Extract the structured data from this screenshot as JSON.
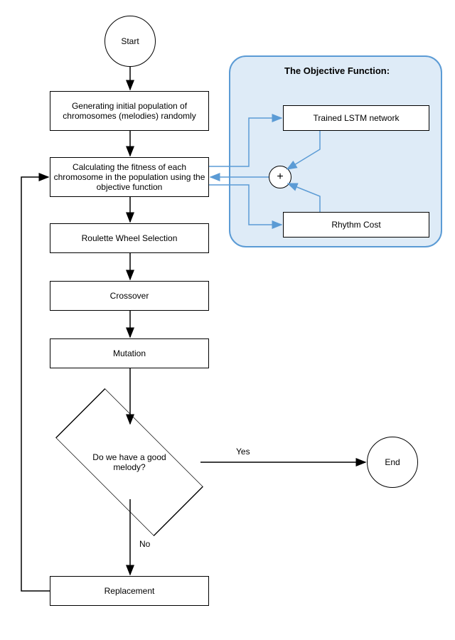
{
  "terminals": {
    "start": "Start",
    "end": "End"
  },
  "processes": {
    "generate": "Generating initial population of chromosomes (melodies) randomly",
    "fitness": "Calculating the fitness of each chromosome in the population using the objective function",
    "selection": "Roulette Wheel Selection",
    "crossover": "Crossover",
    "mutation": "Mutation",
    "replacement": "Replacement"
  },
  "decision": {
    "melody": "Do we have a good melody?"
  },
  "objective": {
    "title": "The Objective Function:",
    "lstm": "Trained LSTM network",
    "rhythm": "Rhythm Cost",
    "plus": "+"
  },
  "labels": {
    "yes": "Yes",
    "no": "No"
  }
}
